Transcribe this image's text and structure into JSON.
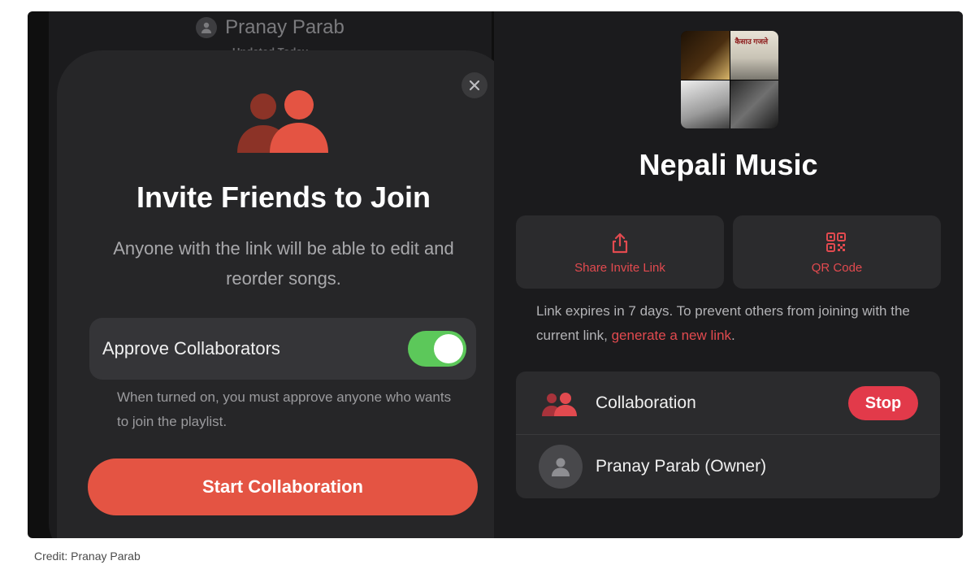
{
  "left_screen": {
    "owner_name": "Pranay Parab",
    "updated": "Updated Today",
    "sheet": {
      "close_icon": "close-icon",
      "people_icon": "people-icon",
      "title": "Invite Friends to Join",
      "subtitle": "Anyone with the link will be able to edit and reorder songs.",
      "approve_label": "Approve Collaborators",
      "approve_enabled": true,
      "approve_note": "When turned on, you must approve anyone who wants to join the playlist.",
      "start_button": "Start Collaboration"
    }
  },
  "right_screen": {
    "playlist_title": "Nepali Music",
    "artwork_caption": "कैसाउ गजले",
    "share_invite_label": "Share Invite Link",
    "qr_code_label": "QR Code",
    "expire_note_prefix": "Link expires in 7 days. To prevent others from joining with the current link, ",
    "expire_note_link": "generate a new link",
    "expire_note_suffix": ".",
    "collaboration_label": "Collaboration",
    "stop_button": "Stop",
    "owner_label": "Pranay Parab (Owner)"
  },
  "colors": {
    "accent_red": "#e24a4f",
    "start_button": "#e45443",
    "toggle_on": "#5cc85a"
  },
  "credit": "Credit: Pranay Parab"
}
